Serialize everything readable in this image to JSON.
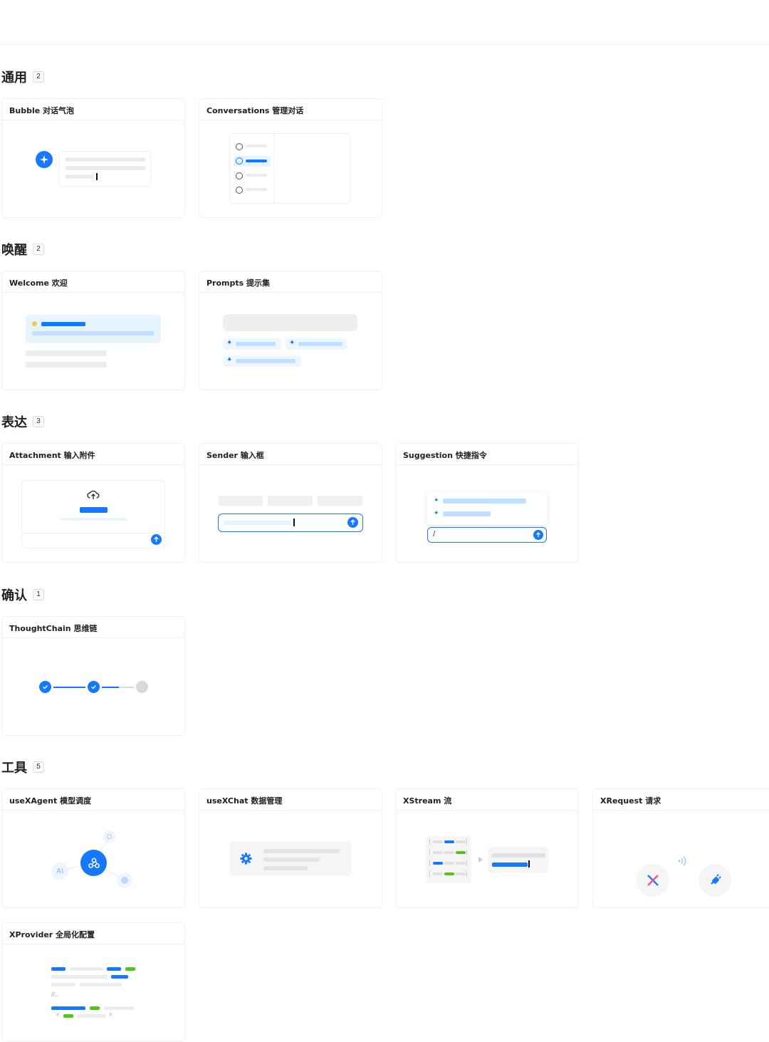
{
  "sections": [
    {
      "name": "通用",
      "count": "2",
      "cards": [
        {
          "title": "Bubble 对话气泡"
        },
        {
          "title": "Conversations 管理对话"
        }
      ]
    },
    {
      "name": "唤醒",
      "count": "2",
      "cards": [
        {
          "title": "Welcome 欢迎"
        },
        {
          "title": "Prompts 提示集"
        }
      ]
    },
    {
      "name": "表达",
      "count": "3",
      "cards": [
        {
          "title": "Attachment 输入附件"
        },
        {
          "title": "Sender 输入框"
        },
        {
          "title": "Suggestion 快捷指令"
        }
      ]
    },
    {
      "name": "确认",
      "count": "1",
      "cards": [
        {
          "title": "ThoughtChain 思维链"
        }
      ]
    },
    {
      "name": "工具",
      "count": "5",
      "cards": [
        {
          "title": "useXAgent 模型调度"
        },
        {
          "title": "useXChat 数据管理"
        },
        {
          "title": "XStream 流"
        },
        {
          "title": "XRequest 请求"
        },
        {
          "title": "XProvider 全局化配置"
        }
      ]
    }
  ],
  "previews": {
    "suggestion_input_value": "/",
    "xprovider_comment": "//...",
    "xprovider_lt": "<",
    "xprovider_gt": ">",
    "xstream_brace_open": "{",
    "xstream_brace_close": "}"
  },
  "icons": {
    "bubble_avatar": "sparkle-icon",
    "conversation_item": "chat-bubble-icon",
    "welcome": "wave-icon",
    "prompt_item": "sparkle-icon",
    "upload": "cloud-upload-icon",
    "send": "arrow-up-circle-icon",
    "thought_done": "check-icon",
    "agent_center": "webhook-icon",
    "agent_ai": "ai-icon",
    "chat_settings": "gear-icon",
    "request_x": "x-logo-icon",
    "request_signal": "signal-icon",
    "request_plug": "plug-icon"
  },
  "colors": {
    "accent": "#1677ff",
    "accent_light": "#bfe0ff",
    "success": "#52c41a",
    "border": "#f0f0f0",
    "placeholder": "#ececec"
  }
}
